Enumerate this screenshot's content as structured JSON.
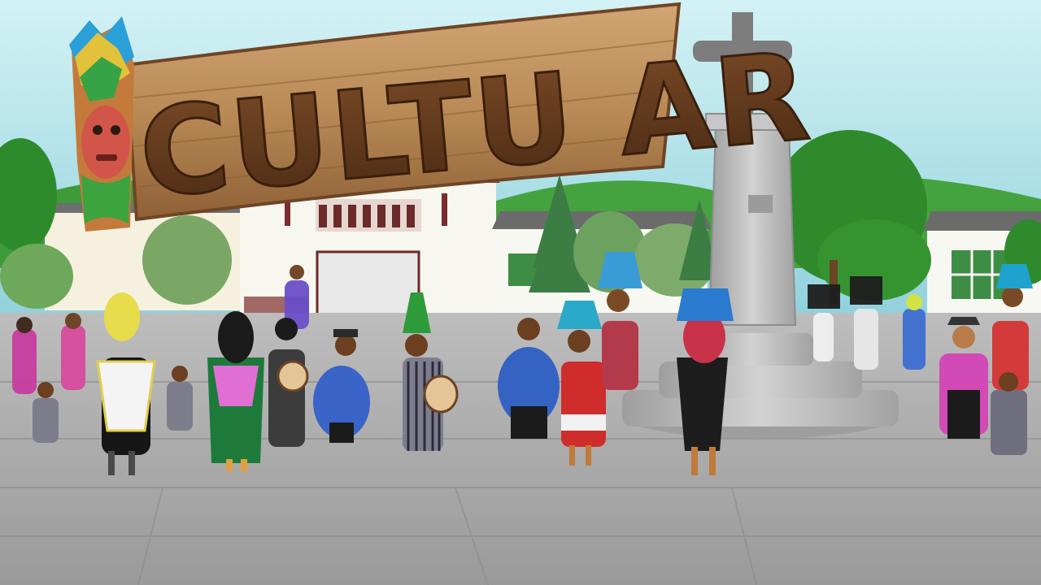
{
  "game": {
    "logo_text": "CULTU AR"
  },
  "colors": {
    "sky_top": "#c8eef3",
    "sky_bottom": "#8fd3de",
    "hill": "#3f9a3a",
    "plaza": "#a9a9a9",
    "plaza_dark": "#8f8f8f",
    "wood": "#b98a56",
    "wood_dark": "#6e4526",
    "monument": "#b8b8b8",
    "tree": "#2f8a2c",
    "pine": "#3c7d44"
  },
  "icons": {
    "logo": "wooden-sign-logo",
    "mask": "indigenous-mask-icon",
    "cross": "cross-monument-icon"
  }
}
